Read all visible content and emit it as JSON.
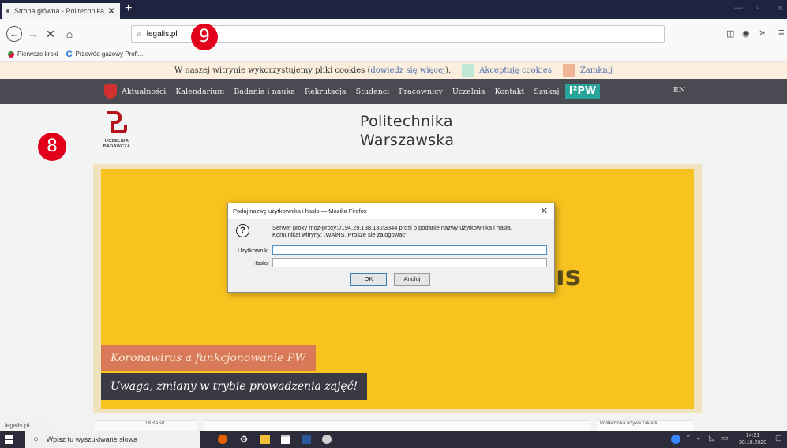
{
  "browser": {
    "tab_title": "Strona główna - Politechnika W",
    "tab_close": "✕",
    "new_tab": "+",
    "window_controls": {
      "minimize": "—",
      "restore": "▫",
      "close": "✕"
    },
    "nav": {
      "back": "←",
      "forward": "→",
      "stop": "✕",
      "home": "⌂"
    },
    "url": "legalis.pl",
    "toolbar_icons": [
      "reader-icon",
      "account-icon",
      "overflow-icon",
      "menu-icon"
    ],
    "toolbar_glyphs": {
      "reader": "◫",
      "account": "◉",
      "overflow": "»",
      "menu": "≡"
    }
  },
  "bookmarks": [
    {
      "label": "Pierwsze kroki",
      "icon": "firefox-icon"
    },
    {
      "label": "Przewód gazowy Profi...",
      "icon": "bookmark-c-icon"
    }
  ],
  "cookie_bar": {
    "text_before": "W naszej witrynie wykorzystujemy pliki cookies (",
    "link": "dowiedz się więcej",
    "text_after": ").",
    "accept_label": "Akceptuję cookies",
    "close_label": "Zamknij"
  },
  "site_nav": {
    "items": [
      "Aktualności",
      "Kalendarium",
      "Badania i nauka",
      "Rekrutacja",
      "Studenci",
      "Pracownicy",
      "Uczelnia",
      "Kontakt",
      "Szukaj"
    ],
    "ipw_label": "I²PW",
    "lang": "EN"
  },
  "header": {
    "ub_text_line1": "UCZELNIA",
    "ub_text_line2": "BADAWCZA",
    "title_line1": "Politechnika",
    "title_line2": "Warszawska"
  },
  "badges": {
    "left": "8",
    "top": "9"
  },
  "hero": {
    "partial_text": "ıs",
    "news1": "Koronawirus a funkcjonowanie PW",
    "news2": "Uwaga, zmiany w trybie prowadzenia zajęć!"
  },
  "below_fold": {
    "left_text": "...l KRASP",
    "right_text": "Politechnika wzywa zakładu..."
  },
  "status_url": "legalis.pl",
  "dialog": {
    "title": "Podaj nazwę użytkownika i hasło — Mozilla Firefox",
    "close": "✕",
    "icon": "?",
    "message_line1": "Serwer proxy moz-proxy://194.29.138.130:3344 prosi o podanie nazwy użytkownika i hasła.",
    "message_line2": "Komunikat witryny: „WAiNS. Prosze sie zalogowac”",
    "user_label": "Użytkownik:",
    "user_value": "",
    "password_label": "Hasło:",
    "password_value": "",
    "ok_label": "OK",
    "cancel_label": "Anuluj"
  },
  "taskbar": {
    "search_placeholder": "Wpisz tu wyszukiwane słowa",
    "search_icon": "○",
    "time": "14:21",
    "date": "30.10.2020",
    "colors": {
      "firefox": "#e66000",
      "gear": "#ffffff",
      "explorer": "#f2c036",
      "store": "#ffffff",
      "word": "#2b579a",
      "paint": "#d0d0d0"
    }
  },
  "colors": {
    "accent_red": "#e2001a",
    "hero_yellow": "#f8c31f",
    "nav_dark": "#4a4a52",
    "ipw_teal": "#2aa39a"
  }
}
